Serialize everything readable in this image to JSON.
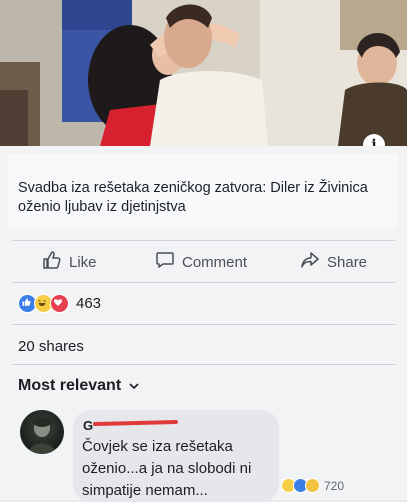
{
  "post": {
    "headline": "Svadba iza rešetaka zeničkog zatvora: Diler iz Živinica oženio ljubav iz djetinjstva",
    "info_icon_label": "i"
  },
  "actions": {
    "like": "Like",
    "comment": "Comment",
    "share": "Share"
  },
  "stats": {
    "reaction_icons": [
      "like-icon",
      "haha-icon",
      "love-icon"
    ],
    "reactions_count": "463",
    "shares": "20 shares"
  },
  "comments": {
    "sort_label": "Most relevant",
    "items": [
      {
        "author_initial": "G",
        "text": "Čovjek se iza rešetaka oženio...a ja na slobodi ni simpatije nemam...",
        "reactions_count": "720",
        "reaction_icons": [
          "haha-icon",
          "like-icon",
          "sad-icon"
        ]
      }
    ]
  },
  "colors": {
    "like_blue": "#3b7fe6",
    "love_red": "#e7404f",
    "haha_yellow": "#f7cd46",
    "redaction_red": "#e03a3a"
  }
}
